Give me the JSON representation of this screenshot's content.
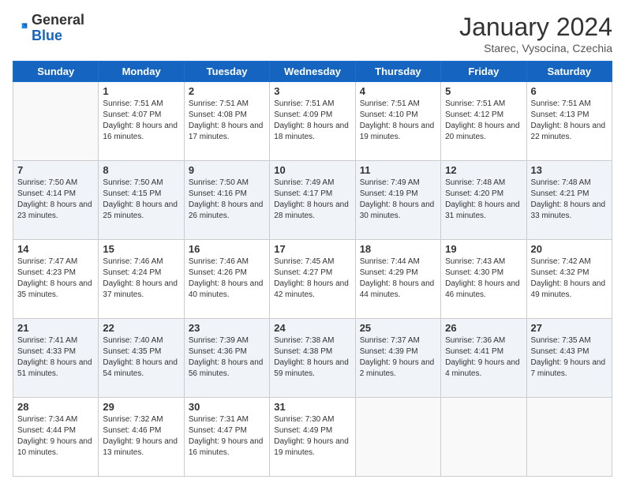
{
  "header": {
    "logo": {
      "general": "General",
      "blue": "Blue"
    },
    "title": "January 2024",
    "subtitle": "Starec, Vysocina, Czechia"
  },
  "days_of_week": [
    "Sunday",
    "Monday",
    "Tuesday",
    "Wednesday",
    "Thursday",
    "Friday",
    "Saturday"
  ],
  "weeks": [
    [
      {
        "day": "",
        "sunrise": "",
        "sunset": "",
        "daylight": ""
      },
      {
        "day": "1",
        "sunrise": "Sunrise: 7:51 AM",
        "sunset": "Sunset: 4:07 PM",
        "daylight": "Daylight: 8 hours and 16 minutes."
      },
      {
        "day": "2",
        "sunrise": "Sunrise: 7:51 AM",
        "sunset": "Sunset: 4:08 PM",
        "daylight": "Daylight: 8 hours and 17 minutes."
      },
      {
        "day": "3",
        "sunrise": "Sunrise: 7:51 AM",
        "sunset": "Sunset: 4:09 PM",
        "daylight": "Daylight: 8 hours and 18 minutes."
      },
      {
        "day": "4",
        "sunrise": "Sunrise: 7:51 AM",
        "sunset": "Sunset: 4:10 PM",
        "daylight": "Daylight: 8 hours and 19 minutes."
      },
      {
        "day": "5",
        "sunrise": "Sunrise: 7:51 AM",
        "sunset": "Sunset: 4:12 PM",
        "daylight": "Daylight: 8 hours and 20 minutes."
      },
      {
        "day": "6",
        "sunrise": "Sunrise: 7:51 AM",
        "sunset": "Sunset: 4:13 PM",
        "daylight": "Daylight: 8 hours and 22 minutes."
      }
    ],
    [
      {
        "day": "7",
        "sunrise": "Sunrise: 7:50 AM",
        "sunset": "Sunset: 4:14 PM",
        "daylight": "Daylight: 8 hours and 23 minutes."
      },
      {
        "day": "8",
        "sunrise": "Sunrise: 7:50 AM",
        "sunset": "Sunset: 4:15 PM",
        "daylight": "Daylight: 8 hours and 25 minutes."
      },
      {
        "day": "9",
        "sunrise": "Sunrise: 7:50 AM",
        "sunset": "Sunset: 4:16 PM",
        "daylight": "Daylight: 8 hours and 26 minutes."
      },
      {
        "day": "10",
        "sunrise": "Sunrise: 7:49 AM",
        "sunset": "Sunset: 4:17 PM",
        "daylight": "Daylight: 8 hours and 28 minutes."
      },
      {
        "day": "11",
        "sunrise": "Sunrise: 7:49 AM",
        "sunset": "Sunset: 4:19 PM",
        "daylight": "Daylight: 8 hours and 30 minutes."
      },
      {
        "day": "12",
        "sunrise": "Sunrise: 7:48 AM",
        "sunset": "Sunset: 4:20 PM",
        "daylight": "Daylight: 8 hours and 31 minutes."
      },
      {
        "day": "13",
        "sunrise": "Sunrise: 7:48 AM",
        "sunset": "Sunset: 4:21 PM",
        "daylight": "Daylight: 8 hours and 33 minutes."
      }
    ],
    [
      {
        "day": "14",
        "sunrise": "Sunrise: 7:47 AM",
        "sunset": "Sunset: 4:23 PM",
        "daylight": "Daylight: 8 hours and 35 minutes."
      },
      {
        "day": "15",
        "sunrise": "Sunrise: 7:46 AM",
        "sunset": "Sunset: 4:24 PM",
        "daylight": "Daylight: 8 hours and 37 minutes."
      },
      {
        "day": "16",
        "sunrise": "Sunrise: 7:46 AM",
        "sunset": "Sunset: 4:26 PM",
        "daylight": "Daylight: 8 hours and 40 minutes."
      },
      {
        "day": "17",
        "sunrise": "Sunrise: 7:45 AM",
        "sunset": "Sunset: 4:27 PM",
        "daylight": "Daylight: 8 hours and 42 minutes."
      },
      {
        "day": "18",
        "sunrise": "Sunrise: 7:44 AM",
        "sunset": "Sunset: 4:29 PM",
        "daylight": "Daylight: 8 hours and 44 minutes."
      },
      {
        "day": "19",
        "sunrise": "Sunrise: 7:43 AM",
        "sunset": "Sunset: 4:30 PM",
        "daylight": "Daylight: 8 hours and 46 minutes."
      },
      {
        "day": "20",
        "sunrise": "Sunrise: 7:42 AM",
        "sunset": "Sunset: 4:32 PM",
        "daylight": "Daylight: 8 hours and 49 minutes."
      }
    ],
    [
      {
        "day": "21",
        "sunrise": "Sunrise: 7:41 AM",
        "sunset": "Sunset: 4:33 PM",
        "daylight": "Daylight: 8 hours and 51 minutes."
      },
      {
        "day": "22",
        "sunrise": "Sunrise: 7:40 AM",
        "sunset": "Sunset: 4:35 PM",
        "daylight": "Daylight: 8 hours and 54 minutes."
      },
      {
        "day": "23",
        "sunrise": "Sunrise: 7:39 AM",
        "sunset": "Sunset: 4:36 PM",
        "daylight": "Daylight: 8 hours and 56 minutes."
      },
      {
        "day": "24",
        "sunrise": "Sunrise: 7:38 AM",
        "sunset": "Sunset: 4:38 PM",
        "daylight": "Daylight: 8 hours and 59 minutes."
      },
      {
        "day": "25",
        "sunrise": "Sunrise: 7:37 AM",
        "sunset": "Sunset: 4:39 PM",
        "daylight": "Daylight: 9 hours and 2 minutes."
      },
      {
        "day": "26",
        "sunrise": "Sunrise: 7:36 AM",
        "sunset": "Sunset: 4:41 PM",
        "daylight": "Daylight: 9 hours and 4 minutes."
      },
      {
        "day": "27",
        "sunrise": "Sunrise: 7:35 AM",
        "sunset": "Sunset: 4:43 PM",
        "daylight": "Daylight: 9 hours and 7 minutes."
      }
    ],
    [
      {
        "day": "28",
        "sunrise": "Sunrise: 7:34 AM",
        "sunset": "Sunset: 4:44 PM",
        "daylight": "Daylight: 9 hours and 10 minutes."
      },
      {
        "day": "29",
        "sunrise": "Sunrise: 7:32 AM",
        "sunset": "Sunset: 4:46 PM",
        "daylight": "Daylight: 9 hours and 13 minutes."
      },
      {
        "day": "30",
        "sunrise": "Sunrise: 7:31 AM",
        "sunset": "Sunset: 4:47 PM",
        "daylight": "Daylight: 9 hours and 16 minutes."
      },
      {
        "day": "31",
        "sunrise": "Sunrise: 7:30 AM",
        "sunset": "Sunset: 4:49 PM",
        "daylight": "Daylight: 9 hours and 19 minutes."
      },
      {
        "day": "",
        "sunrise": "",
        "sunset": "",
        "daylight": ""
      },
      {
        "day": "",
        "sunrise": "",
        "sunset": "",
        "daylight": ""
      },
      {
        "day": "",
        "sunrise": "",
        "sunset": "",
        "daylight": ""
      }
    ]
  ]
}
